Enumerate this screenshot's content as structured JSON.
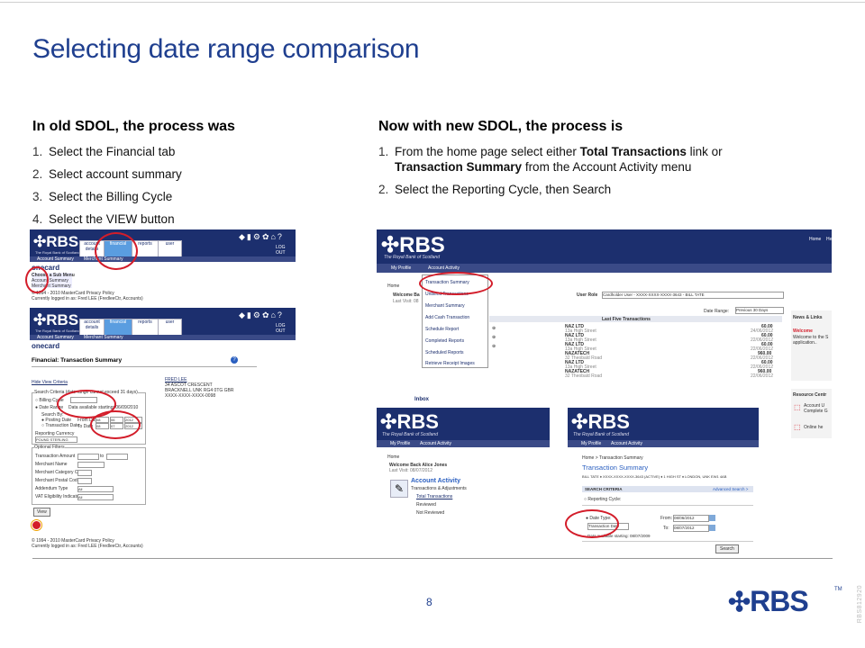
{
  "slide": {
    "title": "Selecting date range comparison",
    "page_number": "8",
    "side_code": "RBS812920"
  },
  "old": {
    "heading": "In old SDOL, the process was",
    "steps": [
      {
        "num": "1.",
        "text": "Select the Financial tab"
      },
      {
        "num": "2.",
        "text": "Select account summary"
      },
      {
        "num": "3.",
        "text": "Select the Billing Cycle"
      },
      {
        "num": "4.",
        "text": "Select the VIEW button"
      }
    ]
  },
  "new": {
    "heading": "Now with new SDOL, the process is",
    "steps": [
      {
        "num": "1.",
        "text_a": "From the home page select either ",
        "bold_a": "Total Transactions",
        "text_b": " link or ",
        "bold_b": "Transaction Summary",
        "text_c": " from the Account Activity menu"
      },
      {
        "num": "2.",
        "text": "Select the Reporting Cycle, then Search"
      }
    ]
  },
  "brand": {
    "logo": "RBS",
    "tagline": "The Royal Bank of Scotland",
    "tm": "TM",
    "colors": {
      "navy": "#1c2f6e",
      "title_blue": "#1f3f8f",
      "red": "#d31d2a"
    }
  },
  "old_screens": {
    "logout": "LOG OUT",
    "tabs": [
      "account details",
      "financial",
      "reports",
      "user"
    ],
    "subnav": [
      "Account Summary",
      "Merchant Summary"
    ],
    "menu_title": "Choose a Sub Menu",
    "menu_items": [
      "Account Summary",
      "Merchant Summary"
    ],
    "onecard": "onecard",
    "footer_1": "© 1994 - 2010 MasterCard  Privacy Policy",
    "footer_2": "Currently logged in as: Fred LEE (FredleeCtr, Accounts)",
    "page_title": "Financial: Transaction Summary",
    "hide_view": "Hide View Criteria",
    "address": [
      "FRED LEE",
      "34 ASCOT CRESCENT",
      "BRACKNELL UNK RG4 0TG GBR",
      "XXXX-XXXX-XXXX-0098"
    ],
    "search_legend": "Search Criteria (date range cannot exceed 31 days)",
    "billing_cycle": "Billing Cycle",
    "date_range": "Date Range",
    "data_available": "Data available starting: 06/09/2010",
    "search_by": "Search By:",
    "posting_date": "Posting Date",
    "transaction_date": "Transaction Date",
    "from_date": "From Date",
    "to_date": "To Date",
    "from_vals": [
      "08",
      "06",
      "2012"
    ],
    "to_vals": [
      "08",
      "07",
      "2012"
    ],
    "reporting_currency": "Reporting Currency",
    "currency_value": "POUND STERLING",
    "optional_filters": "Optional Filters",
    "filter_labels": [
      "Transaction Amount",
      "Merchant Name",
      "Merchant Category Code",
      "Merchant Postal Code",
      "Addendum Type",
      "VAT Eligibility Indicator"
    ],
    "to_label": "to",
    "all_value": "All",
    "view_button": "View",
    "footer2_1": "© 1994 - 2010 MasterCard  Privacy Policy",
    "footer2_2": "Currently logged in as: Fred LEE (FredleeCtr, Accounts)"
  },
  "new_screen_1": {
    "nav_home": "Home",
    "nav_he": "He",
    "tabs": [
      "My Profile",
      "Account Activity"
    ],
    "breadcrumb": "Home",
    "welcome": "Welcome Ba",
    "last_visit": "Last Visit: 08",
    "menu_items": [
      "Transaction Summary",
      "Unbilled Transactions",
      "Merchant Summary",
      "Add Cash Transaction",
      "Schedule Report",
      "Completed Reports",
      "Scheduled Reports",
      "Retrieve Receipt Images"
    ],
    "user_role_label": "User Role",
    "user_role_value": "Cardholder User - XXXX-XXXX-XXXX-3643 - BILL TATE",
    "date_range_label": "Date Range:",
    "date_range_value": "Previous 30 Days",
    "last_five": "Last Five Transactions",
    "transactions": [
      {
        "name": "NAZ LTD",
        "addr": "13a High Street",
        "amount": "60.00",
        "date": "24/06/2012"
      },
      {
        "name": "NAZ LTD",
        "addr": "13a High Street",
        "amount": "60.00",
        "date": "22/06/2012"
      },
      {
        "name": "NAZ LTD",
        "addr": "13a High Street",
        "amount": "60.00",
        "date": "22/06/2012"
      },
      {
        "name": "NAZATECH",
        "addr": "32 Theobald Road",
        "amount": "960.00",
        "date": "22/06/2012"
      },
      {
        "name": "NAZ LTD",
        "addr": "13a High Street",
        "amount": "60.00",
        "date": "22/06/2012"
      },
      {
        "name": "NAZATECH",
        "addr": "32 Theobald Road",
        "amount": "960.00",
        "date": "22/06/2012"
      }
    ],
    "news_title": "News & Links",
    "news_welcome": "Welcome",
    "news_text_1": "Welcome to the S",
    "news_text_2": "application..",
    "resource_title": "Resource Centr",
    "resource_1a": "Account U",
    "resource_1b": "Complete G",
    "resource_2a": "Online he",
    "inbox": "Inbox"
  },
  "new_screen_2": {
    "tabs": [
      "My Profile",
      "Account Activity"
    ],
    "breadcrumb": "Home",
    "welcome": "Welcome Back Alice Jones",
    "last_visit": "Last Visit: 08/07/2012",
    "activity_title": "Account Activity",
    "activity_sub": "Transactions & Adjustments",
    "links": [
      "Total Transactions",
      "Reviewed",
      "Not Reviewed"
    ]
  },
  "new_screen_3": {
    "tabs": [
      "My Profile",
      "Account Activity"
    ],
    "breadcrumb": "Home > Transaction Summary",
    "title": "Transaction Summary",
    "account_line": "BILL TATE ♦ XXXX-XXXX-XXXX-3643 (ACTIVE) ♦ 1 HIGH ST ♦ LONDON, UNK EW1 4AB",
    "criteria": "SEARCH CRITERIA",
    "advanced": "Advanced Search >",
    "reporting_cycle": "Reporting Cycle:",
    "date_type": "Date Type:",
    "date_type_value": "Transaction Date",
    "from_label": "From:",
    "from_value": "08/06/2012",
    "to_label": "To:",
    "to_value": "08/07/2012",
    "data_avail": "Data available starting: 08/07/2009",
    "search_button": "Search"
  }
}
